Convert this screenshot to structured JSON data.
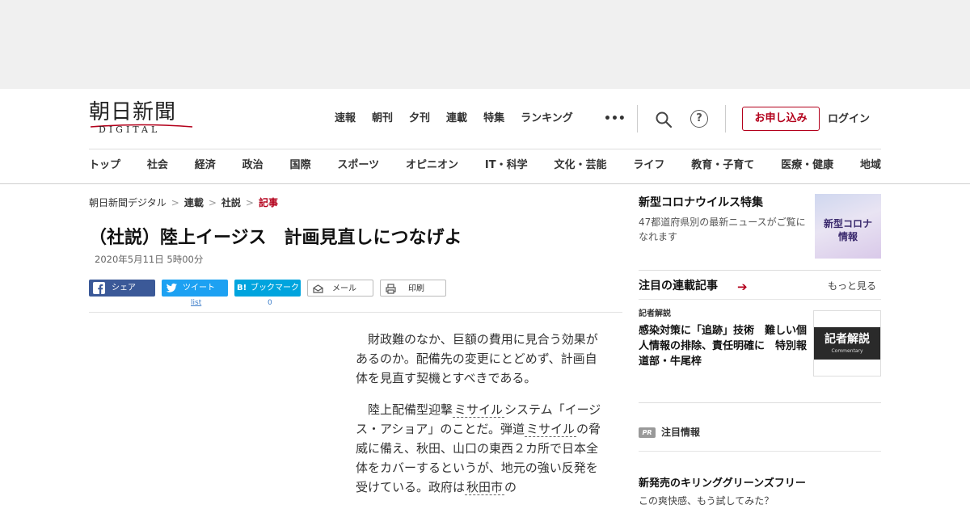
{
  "header": {
    "logo_kanji": "朝日新聞",
    "logo_latin": "DIGITAL",
    "global_nav": [
      "速報",
      "朝刊",
      "夕刊",
      "連載",
      "特集",
      "ランキング"
    ],
    "more_label": "•••",
    "help_label": "?",
    "subscribe_label": "お申し込み",
    "login_label": "ログイン",
    "categories": [
      "トップ",
      "社会",
      "経済",
      "政治",
      "国際",
      "スポーツ",
      "オピニオン",
      "IT・科学",
      "文化・芸能",
      "ライフ",
      "教育・子育て",
      "医療・健康",
      "地域"
    ]
  },
  "breadcrumb": {
    "items": [
      "朝日新聞デジタル",
      "連載",
      "社説"
    ],
    "current": "記事",
    "separator": ">"
  },
  "article": {
    "title": "（社説）陸上イージス　計画見直しにつなげよ",
    "date": "2020年5月11日 5時00分",
    "p1": "財政難のなか、巨額の費用に見合う効果があるのか。配備先の変更にとどめず、計画自体を見直す契機とすべきである。",
    "p2_a": "陸上配備型迎撃",
    "p2_kw1": "ミサイル",
    "p2_b": "システム「イージス・アショア」のことだ。弾道",
    "p2_kw2": "ミサイル",
    "p2_c": "の脅威に備え、秋田、山口の東西２カ所で日本全体をカバーするというが、地元の強い反発を受けている。政府は",
    "p2_kw3": "秋田市",
    "p2_d": "の"
  },
  "share": {
    "facebook": "シェア",
    "twitter": "ツイート",
    "twitter_count": "list",
    "hatena_logo": "B!",
    "hatena": "ブックマーク",
    "hatena_count": "0",
    "mail": "メール",
    "print": "印刷"
  },
  "sidebar": {
    "corona_title": "新型コロナウイルス特集",
    "corona_text": "47都道府県別の最新ニュースがご覧になれます",
    "corona_thumb_line1": "新型コロナ",
    "corona_thumb_line2": "情報",
    "series_title": "注目の連載記事",
    "series_more": "もっと見る",
    "item_tag": "記者解説",
    "item_title": "感染対策に「追跡」技術　難しい個人情報の排除、責任明確に　特別報道部・牛尾梓",
    "item_thumb_big": "記者解説",
    "item_thumb_small": "Commentary",
    "pr_badge": "PR",
    "pr_label": "注目情報",
    "pr_title": "新発売のキリンググリーンズフリー",
    "pr_text": "この爽快感、もう試してみた？"
  },
  "colors": {
    "accent_red": "#b3001b",
    "facebook": "#3b5998",
    "twitter": "#1da1f2",
    "hatena": "#00a4de"
  }
}
